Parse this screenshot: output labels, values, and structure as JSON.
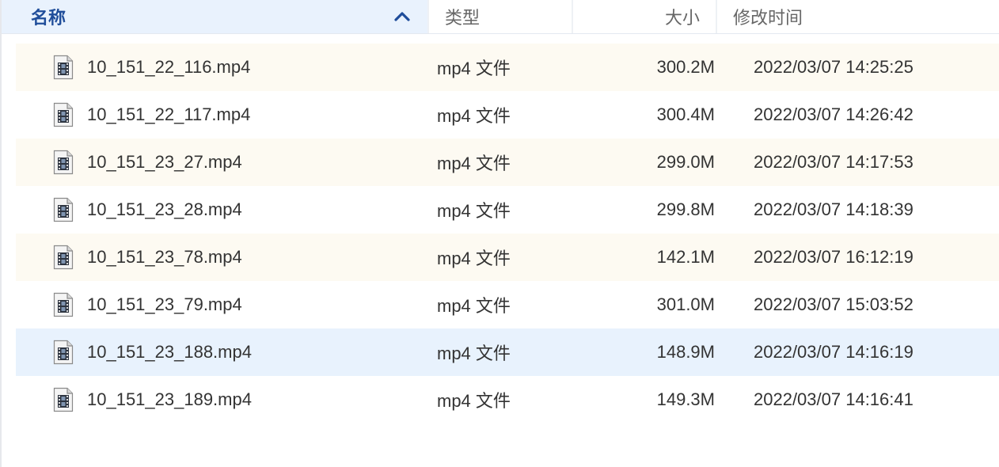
{
  "header": {
    "name_label": "名称",
    "type_label": "类型",
    "size_label": "大小",
    "time_label": "修改时间",
    "sort_icon": "chevron-up-icon"
  },
  "file_icon": "video-file-icon",
  "colors": {
    "header_active_bg": "#e9f2fd",
    "header_active_text": "#1f4d9a",
    "row_alt_bg": "#fdfaf2",
    "row_selected_bg": "#e8f2fd"
  },
  "files": [
    {
      "name": "10_151_22_116.mp4",
      "type": "mp4 文件",
      "size": "300.2M",
      "modified": "2022/03/07 14:25:25"
    },
    {
      "name": "10_151_22_117.mp4",
      "type": "mp4 文件",
      "size": "300.4M",
      "modified": "2022/03/07 14:26:42"
    },
    {
      "name": "10_151_23_27.mp4",
      "type": "mp4 文件",
      "size": "299.0M",
      "modified": "2022/03/07 14:17:53"
    },
    {
      "name": "10_151_23_28.mp4",
      "type": "mp4 文件",
      "size": "299.8M",
      "modified": "2022/03/07 14:18:39"
    },
    {
      "name": "10_151_23_78.mp4",
      "type": "mp4 文件",
      "size": "142.1M",
      "modified": "2022/03/07 16:12:19"
    },
    {
      "name": "10_151_23_79.mp4",
      "type": "mp4 文件",
      "size": "301.0M",
      "modified": "2022/03/07 15:03:52"
    },
    {
      "name": "10_151_23_188.mp4",
      "type": "mp4 文件",
      "size": "148.9M",
      "modified": "2022/03/07 14:16:19",
      "selected": true
    },
    {
      "name": "10_151_23_189.mp4",
      "type": "mp4 文件",
      "size": "149.3M",
      "modified": "2022/03/07 14:16:41"
    }
  ]
}
